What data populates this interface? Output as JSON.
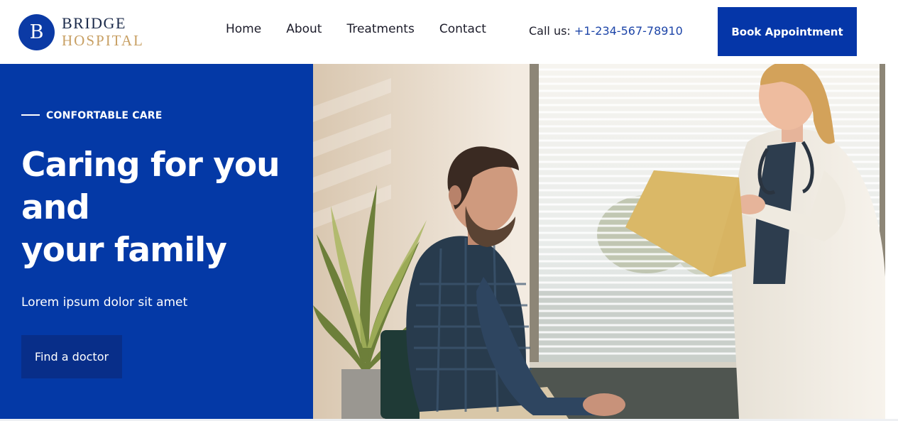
{
  "brand": {
    "badge_letter": "B",
    "name_top": "BRIDGE",
    "name_bottom": "HOSPITAL",
    "colors": {
      "primary": "#0439a6",
      "gold": "#c8a064",
      "dark": "#1b2a4a"
    }
  },
  "nav": {
    "items": [
      {
        "label": "Home"
      },
      {
        "label": "About"
      },
      {
        "label": "Treatments"
      },
      {
        "label": "Contact"
      }
    ]
  },
  "contact": {
    "call_label": "Call us: ",
    "phone": "+1-234-567-78910"
  },
  "header": {
    "book_button": "Book Appointment"
  },
  "hero": {
    "eyebrow": "CONFORTABLE CARE",
    "headline_lines": [
      "Caring for you",
      "and",
      "your family"
    ],
    "subtext": "Lorem ipsum dolor sit amet",
    "cta": "Find a doctor",
    "image_alt": "Doctor holding a folder talking with a smiling patient"
  }
}
